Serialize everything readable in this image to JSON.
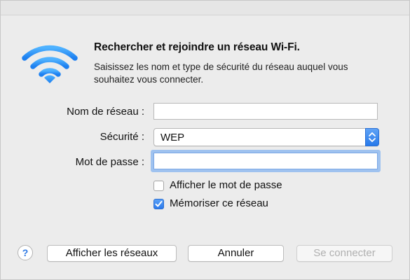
{
  "dialog": {
    "title": "Rechercher et rejoindre un réseau Wi-Fi.",
    "subtitle": "Saisissez les nom et type de sécurité du réseau auquel vous souhaitez vous connecter.",
    "accent_color": "#2f7ae5"
  },
  "form": {
    "network_name_label": "Nom de réseau :",
    "network_name_value": "",
    "security_label": "Sécurité :",
    "security_value": "WEP",
    "password_label": "Mot de passe :",
    "password_value": ""
  },
  "options": {
    "show_password_label": "Afficher le mot de passe",
    "show_password_checked": false,
    "remember_network_label": "Mémoriser ce réseau",
    "remember_network_checked": true
  },
  "buttons": {
    "help_label": "?",
    "show_networks_label": "Afficher les réseaux",
    "cancel_label": "Annuler",
    "connect_label": "Se connecter",
    "connect_enabled": false
  },
  "icons": {
    "wifi": "wifi-icon",
    "select_arrows": "updown-chevron-icon",
    "checkmark": "checkmark-icon"
  }
}
